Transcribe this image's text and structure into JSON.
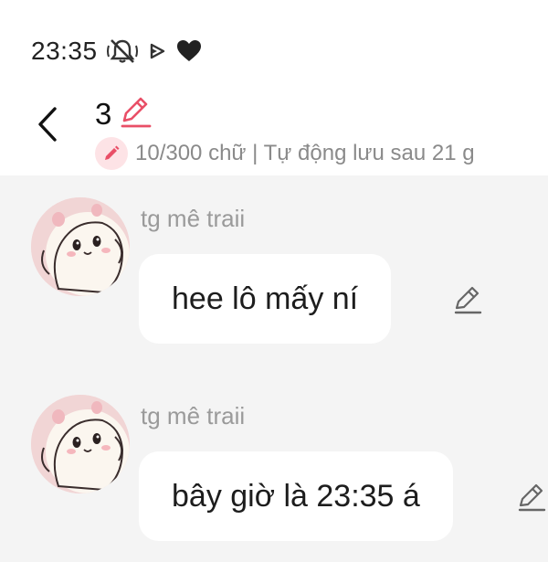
{
  "status_bar": {
    "time": "23:35",
    "icons": [
      "bell-off-icon",
      "play-icon",
      "heart-icon"
    ]
  },
  "header": {
    "title": "3",
    "title_icon": "pencil-icon",
    "meta_icon": "pencil-badge-icon",
    "meta_text": "10/300 chữ | Tự động lưu sau 21 g"
  },
  "messages": [
    {
      "sender": "tg mê traii",
      "text": "hee lô mấy ní",
      "edit_icon": "edit-pencil-icon"
    },
    {
      "sender": "tg mê traii",
      "text": "bây giờ là 23:35 á",
      "edit_icon": "edit-pencil-icon"
    }
  ],
  "colors": {
    "accent": "#e94f67",
    "chat_background": "#f4f4f4",
    "bubble": "#ffffff",
    "meta_text": "#8a8a8a"
  }
}
